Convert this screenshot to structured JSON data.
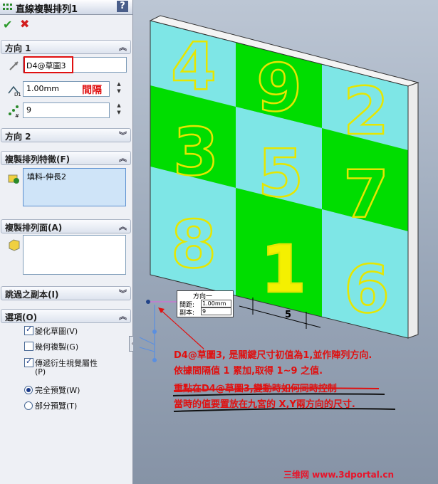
{
  "panel": {
    "title": "直線複製排列1",
    "help_label": "?",
    "direction1": {
      "header": "方向 1",
      "edge_value": "D4@草圖3",
      "spacing_value": "1.00mm",
      "spacing_label": "間隔",
      "count_value": "9"
    },
    "direction2": {
      "header": "方向 2"
    },
    "features": {
      "header": "複製排列特徵(F)",
      "items": [
        "填料-伸長2"
      ]
    },
    "faces": {
      "header": "複製排列面(A)"
    },
    "skip": {
      "header": "跳過之副本(I)"
    },
    "options": {
      "header": "選項(O)",
      "vary_sketch": "變化草圖(V)",
      "geometry_pattern": "幾何複製(G)",
      "propagate": "傳遞衍生視覺屬性",
      "propagate_key": "(P)",
      "full_preview": "完全預覽(W)",
      "partial_preview": "部分預覽(T)"
    }
  },
  "viewport": {
    "grid_numbers": [
      "4",
      "9",
      "2",
      "3",
      "5",
      "7",
      "8",
      "1",
      "6"
    ],
    "dimension_value": "5",
    "dim_popup": {
      "title": "方向一",
      "spacing_label": "間距:",
      "spacing_value": "1.00mm",
      "copies_label": "副本:",
      "copies_value": "9"
    },
    "annotation_line1": "D4@草圖3, 是關鍵尺寸初值為1,並作陣列方向.",
    "annotation_line2": "依據間隔值 1 累加,取得 1~9 之值.",
    "annotation_line3": "重點在D4@草圖3,變動時如何同時控制",
    "annotation_line4": "當時的值要置放在九宮的 X,Y兩方向的尺寸.",
    "watermark": "三维网 www.3dportal.cn"
  },
  "colors": {
    "cell_green": "#00dd00",
    "cell_cyan": "#7ee6e6",
    "digit_outline": "#e6e600",
    "annotation": "#e01010"
  }
}
